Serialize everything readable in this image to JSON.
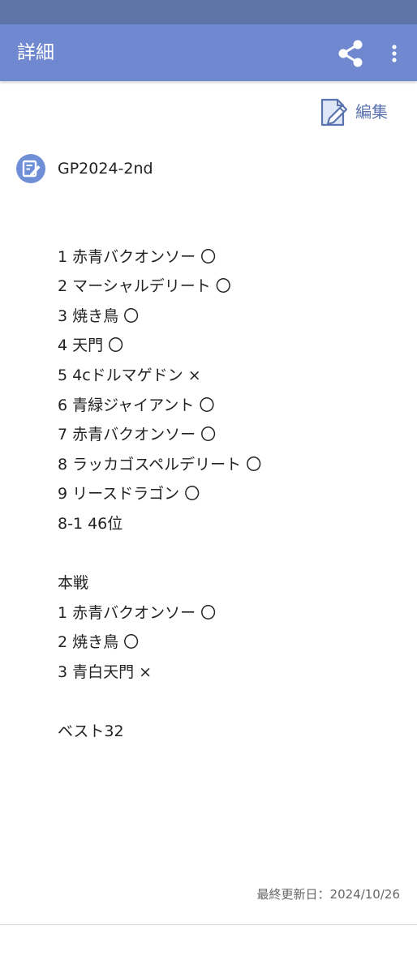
{
  "header": {
    "title": "詳細",
    "share_icon": "share-icon",
    "more_icon": "more-vert-icon",
    "bar_color": "#7088cf",
    "status_bar_color": "#5f75a8"
  },
  "edit": {
    "label": "編集",
    "icon": "edit-document-icon"
  },
  "note": {
    "icon": "note-edit-icon",
    "title": "GP2024-2nd",
    "lines": [
      "",
      "1 赤青バクオンソー 〇",
      "2 マーシャルデリート 〇",
      "3 焼き鳥 〇",
      "4 天門 〇",
      "5 4cドルマゲドン ×",
      "6 青緑ジャイアント 〇",
      "7 赤青バクオンソー 〇",
      "8 ラッカゴスペルデリート 〇",
      "9 リースドラゴン 〇",
      "8-1 46位",
      "",
      "本戦",
      "1 赤青バクオンソー 〇",
      "2 焼き鳥 〇",
      "3 青白天門 ×",
      "",
      "ベスト32"
    ]
  },
  "footer": {
    "last_updated": "最終更新日：2024/10/26"
  }
}
